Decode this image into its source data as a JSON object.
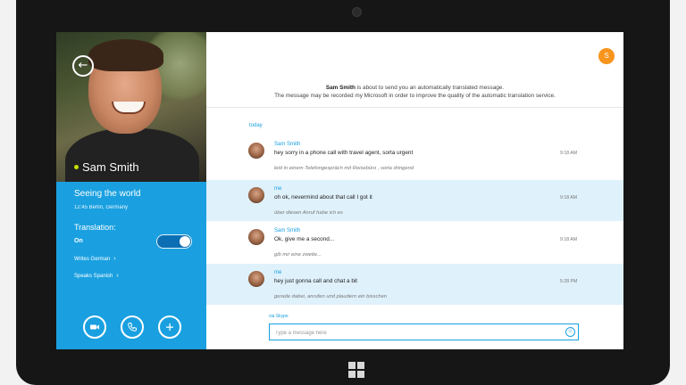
{
  "contact": {
    "name": "Sam Smith",
    "mood": "Seeing the world",
    "location": "12:45 Berlin, Germany"
  },
  "translation": {
    "label": "Translation:",
    "state": "On",
    "writes": "Writes German",
    "speaks": "Speaks Spanish"
  },
  "header": {
    "badge": "S"
  },
  "notice": {
    "name": "Sam Smith",
    "line1_rest": " is about to send you an automatically translated message.",
    "line2": "The message may be recorded my Microsoft in order to improve the quality of the automatic translation service."
  },
  "day_label": "today",
  "messages": [
    {
      "sender": "Sam Smith",
      "text": "hey sorry in a phone call with travel agent, sorta urgent",
      "translation": "leid in einem Telefongespräch mit Reisebüro , sorta dringend",
      "time": "9:18 AM"
    },
    {
      "sender": "me",
      "text": "oh ok, nevermind about that call I got it",
      "translation": "über diesen Anruf habe ich es",
      "time": "9:18 AM"
    },
    {
      "sender": "Sam Smith",
      "text": "Ok, give me a second...",
      "translation": "gib mir eine zweite...",
      "time": "9:18 AM"
    },
    {
      "sender": "me",
      "text": "hey just gonna call and chat a bit",
      "translation": "gerade dabei, anrufen und plaudern ein bisschen",
      "time": "5:28 PM"
    }
  ],
  "composer": {
    "via": "via Skype",
    "placeholder": "Type a message here"
  },
  "colors": {
    "accent": "#1aa0e0",
    "badge": "#f7941d",
    "my_message_bg": "#dff1fb",
    "presence": "#c8e000"
  },
  "icons": [
    "back-arrow-icon",
    "video-icon",
    "phone-icon",
    "add-icon",
    "emoji-icon",
    "windows-logo-icon"
  ]
}
